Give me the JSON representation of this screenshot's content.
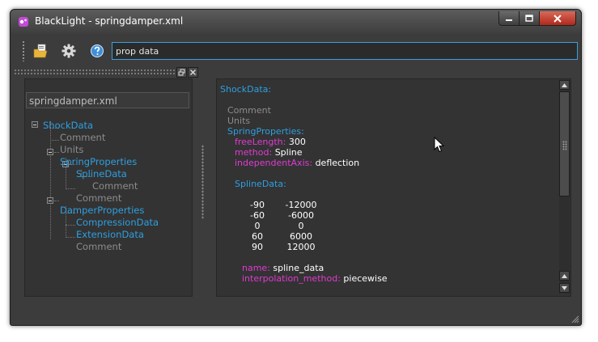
{
  "window": {
    "title": "BlackLight - springdamper.xml"
  },
  "toolbar": {
    "search_value": "prop data"
  },
  "tree": {
    "file": "springdamper.xml",
    "nodes": [
      "ShockData",
      "Comment",
      "Units",
      "SpringProperties",
      "SplineData",
      "Comment",
      "Comment",
      "DamperProperties",
      "CompressionData",
      "ExtensionData",
      "Comment"
    ]
  },
  "detail": {
    "heading": "ShockData:",
    "comment": "Comment",
    "units": "Units",
    "spring_properties": "SpringProperties:",
    "free_length_key": "freeLength:",
    "free_length_val": "300",
    "method_key": "method:",
    "method_val": "Spline",
    "indep_key": "independentAxis:",
    "indep_val": "deflection",
    "spline_data": "SplineData:",
    "table": [
      [
        "-90",
        "-12000"
      ],
      [
        "-60",
        "-6000"
      ],
      [
        "0",
        "0"
      ],
      [
        "60",
        "6000"
      ],
      [
        "90",
        "12000"
      ]
    ],
    "name_key": "name:",
    "name_val": "spline_data",
    "interp_key": "interpolation_method:",
    "interp_val": "piecewise"
  },
  "colors": {
    "blue": "#2e9fe0",
    "magenta": "#e13ad2",
    "gray": "#8c8c8c",
    "focus": "#3aa0d8"
  }
}
